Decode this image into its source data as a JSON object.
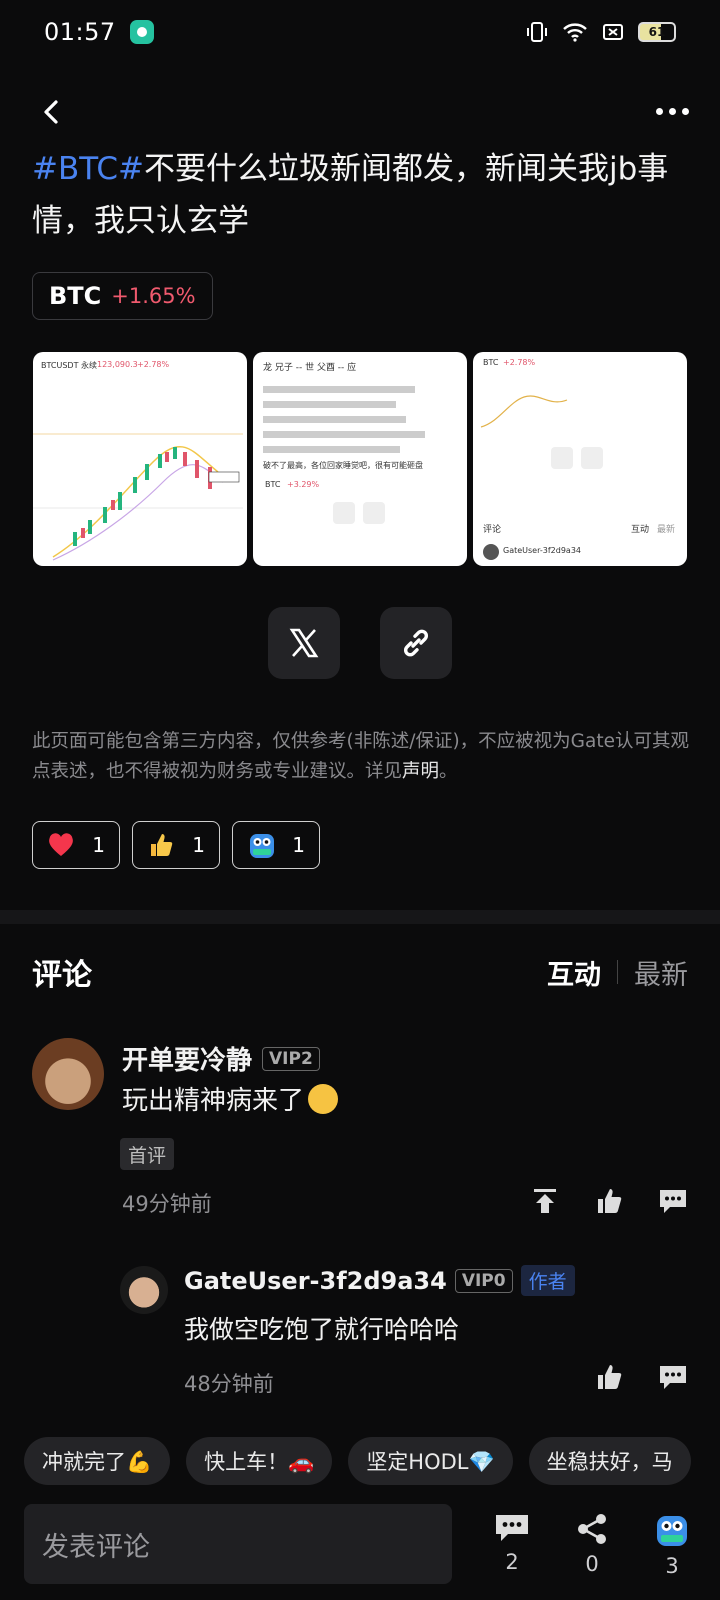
{
  "status_bar": {
    "time": "01:57",
    "battery": "61"
  },
  "post": {
    "title_tag": "#BTC#",
    "title_text": "不要什么垃圾新闻都发，新闻关我jb事情，我只认玄学",
    "coin": {
      "symbol": "BTC",
      "change": "+1.65%"
    },
    "thumbnails": [
      {
        "heading": "BTCUSDT 永续",
        "price": "123,090.3",
        "change": "+2.78%"
      },
      {
        "line1": "龙  兄子 -- 世 父酉 -- 应",
        "line2": "破不了最高，各位回家睡觉吧，很有可能砸盘",
        "coin": "BTC",
        "change": "+3.29%"
      },
      {
        "coin": "BTC",
        "change": "+2.78%",
        "comments_label": "评论",
        "tab": "互动",
        "tab2": "最新",
        "user": "GateUser-3f2d9a34"
      }
    ],
    "disclaimer": "此页面可能包含第三方内容，仅供参考(非陈述/保证)，不应被视为Gate认可其观点表述，也不得被视为财务或专业建议。详见",
    "disclaimer_link": "声明",
    "disclaimer_end": "。",
    "reactions": [
      {
        "icon": "heart",
        "count": "1"
      },
      {
        "icon": "thumbs-up",
        "count": "1"
      },
      {
        "icon": "hodl",
        "count": "1"
      }
    ]
  },
  "comments_section": {
    "heading": "评论",
    "sort_active": "互动",
    "sort_inactive": "最新"
  },
  "comments": [
    {
      "user": "开单要冷静",
      "vip": "VIP2",
      "text": "玩出精神病来了",
      "badge": "首评",
      "time": "49分钟前",
      "reply": {
        "user": "GateUser-3f2d9a34",
        "vip": "VIP0",
        "author_badge": "作者",
        "text": "我做空吃饱了就行哈哈哈",
        "time": "48分钟前"
      }
    }
  ],
  "quick_replies": [
    "冲就完了💪",
    "快上车！🚗",
    "坚定HODL💎",
    "坐稳扶好，马"
  ],
  "bottom_bar": {
    "input_placeholder": "发表评论",
    "comment_count": "2",
    "share_count": "0",
    "hodl_count": "3"
  }
}
